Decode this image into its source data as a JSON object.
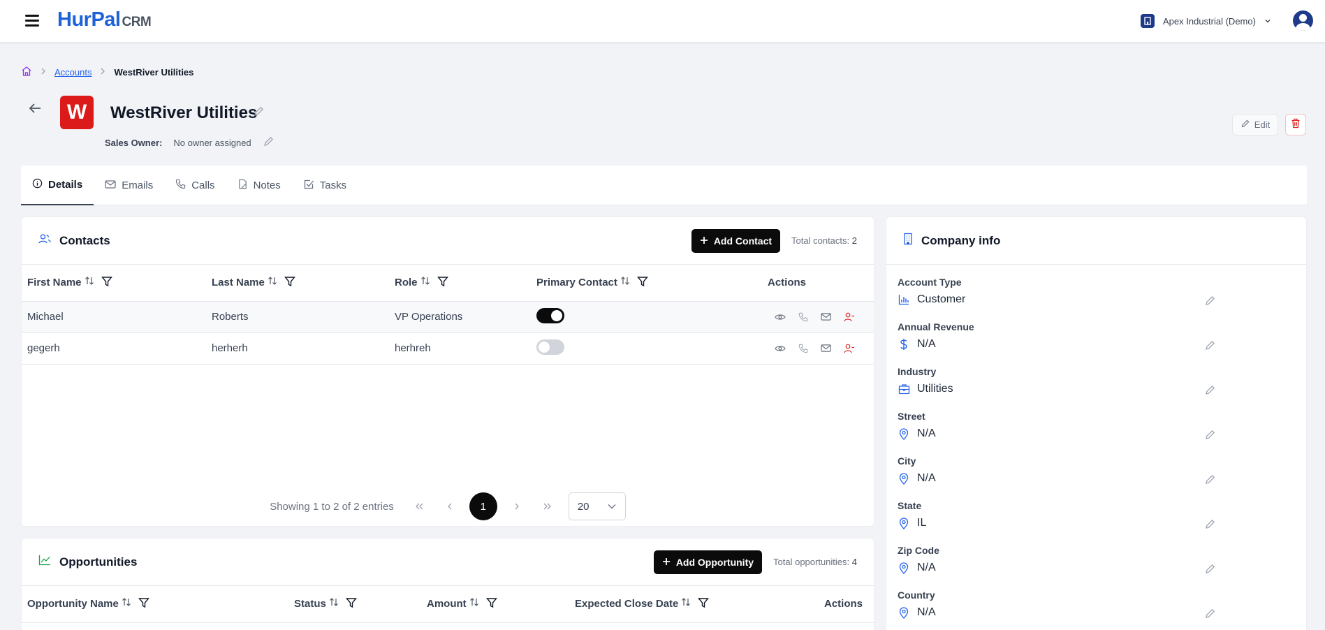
{
  "topbar": {
    "brand": "HurPal",
    "brand_suffix": "CRM",
    "org_name": "Apex Industrial (Demo)"
  },
  "breadcrumb": {
    "accounts": "Accounts",
    "current": "WestRiver Utilities"
  },
  "account": {
    "initial": "W",
    "name": "WestRiver Utilities",
    "owner_label": "Sales Owner:",
    "owner_value": "No owner assigned",
    "edit_label": "Edit"
  },
  "tabs": [
    "Details",
    "Emails",
    "Calls",
    "Notes",
    "Tasks"
  ],
  "contacts": {
    "title": "Contacts",
    "add_label": "Add Contact",
    "total_label": "Total contacts:",
    "total_value": "2",
    "columns": [
      "First Name",
      "Last Name",
      "Role",
      "Primary Contact",
      "Actions"
    ],
    "rows": [
      {
        "first": "Michael",
        "last": "Roberts",
        "role": "VP Operations",
        "primary": true
      },
      {
        "first": "gegerh",
        "last": "herherh",
        "role": "herhreh",
        "primary": false
      }
    ],
    "pager": {
      "showing": "Showing 1 to 2 of 2 entries",
      "page": "1",
      "page_size": "20"
    }
  },
  "opportunities": {
    "title": "Opportunities",
    "add_label": "Add Opportunity",
    "total_label": "Total opportunities:",
    "total_value": "4",
    "columns": [
      "Opportunity Name",
      "Status",
      "Amount",
      "Expected Close Date",
      "Actions"
    ]
  },
  "company_info": {
    "title": "Company info",
    "fields": [
      {
        "label": "Account Type",
        "value": "Customer",
        "icon": "bar-chart-icon"
      },
      {
        "label": "Annual Revenue",
        "value": "N/A",
        "icon": "dollar-icon"
      },
      {
        "label": "Industry",
        "value": "Utilities",
        "icon": "briefcase-icon"
      },
      {
        "label": "Street",
        "value": "N/A",
        "icon": "map-pin-icon"
      },
      {
        "label": "City",
        "value": "N/A",
        "icon": "map-pin-icon"
      },
      {
        "label": "State",
        "value": "IL",
        "icon": "map-pin-icon"
      },
      {
        "label": "Zip Code",
        "value": "N/A",
        "icon": "map-pin-icon"
      },
      {
        "label": "Country",
        "value": "N/A",
        "icon": "map-pin-icon"
      }
    ]
  },
  "colors": {
    "brand_blue": "#1d63d6",
    "accent_black": "#0b0b0b",
    "danger_red": "#dc2626",
    "logo_red": "#dc1a1a"
  }
}
